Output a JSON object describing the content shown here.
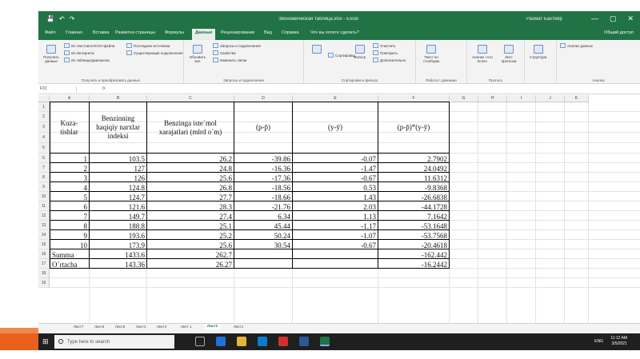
{
  "titlebar": {
    "document": "Экономическая таблица.xlsx  -  Excel",
    "user": "Рахмат Бахтиёр",
    "quick_access": [
      "💾",
      "↶",
      "↷"
    ],
    "window_controls": [
      "—",
      "▢",
      "✕"
    ]
  },
  "tabs": [
    "Файл",
    "Главная",
    "Вставка",
    "Разметка страницы",
    "Формулы",
    "Данные",
    "Рецензирование",
    "Вид",
    "Справка",
    "Что вы хотите сделать?"
  ],
  "active_tab": "Данные",
  "share_label": "Общий доступ",
  "ribbon": {
    "groups": [
      {
        "label": "Получить и преобразовать данные",
        "items": [
          "Получить данные",
          "Из текстового/CSV-файла",
          "Из Интернета",
          "Из таблицы/диапазона",
          "Последние источники",
          "Существующие подключения"
        ]
      },
      {
        "label": "Запросы и подключения",
        "items": [
          "Обновить все",
          "Запросы и подключения",
          "Свойства",
          "Изменить связи"
        ]
      },
      {
        "label": "Сортировка и фильтр",
        "items": [
          "Сортировка",
          "Фильтр",
          "Очистить",
          "Повторить",
          "Дополнительно"
        ]
      },
      {
        "label": "Работа с данными",
        "items": [
          "Текст по столбцам"
        ]
      },
      {
        "label": "Прогноз",
        "items": [
          "Анализ «что если»",
          "Лист прогноза"
        ]
      },
      {
        "label": "Структура",
        "items": [
          "Структура"
        ]
      },
      {
        "label": "Анализ",
        "items": [
          "Анализ данных"
        ]
      }
    ]
  },
  "formula_bar": {
    "name_box": "F31",
    "fx": "fx"
  },
  "columns": [
    "A",
    "B",
    "C",
    "D",
    "E",
    "F",
    "G",
    "H",
    "I",
    "J",
    "K"
  ],
  "rows": [
    "1",
    "2",
    "3",
    "4",
    "5",
    "6",
    "7",
    "8",
    "9",
    "10",
    "11",
    "12",
    "13",
    "14",
    "15",
    "16",
    "17",
    "18",
    "19"
  ],
  "table": {
    "headers": {
      "a": "Kuza-tishlar",
      "b": "Benzinning haqiqiy narxlar indeksi",
      "c": "Benzinga iste`mol xarajatlari (mlrd o`m)",
      "d": "(p-p̄)",
      "e": "(y-ȳ)",
      "f": "(p-p̄)*(y-ȳ)"
    },
    "data": [
      [
        "1",
        "103.5",
        "26.2",
        "-39.86",
        "-0.07",
        "2.7902"
      ],
      [
        "2",
        "127",
        "24.8",
        "-16.36",
        "-1.47",
        "24.0492"
      ],
      [
        "3",
        "126",
        "25.6",
        "-17.36",
        "-0.67",
        "11.6312"
      ],
      [
        "4",
        "124.8",
        "26.8",
        "-18.56",
        "0.53",
        "-9.8368"
      ],
      [
        "5",
        "124.7",
        "27.7",
        "-18.66",
        "1.43",
        "-26.6838"
      ],
      [
        "6",
        "121.6",
        "28.3",
        "-21.76",
        "2.03",
        "-44.1728"
      ],
      [
        "7",
        "149.7",
        "27.4",
        "6.34",
        "1.13",
        "7.1642"
      ],
      [
        "8",
        "188.8",
        "25.1",
        "45.44",
        "-1.17",
        "-53.1648"
      ],
      [
        "9",
        "193.6",
        "25.2",
        "50.24",
        "-1.07",
        "-53.7568"
      ],
      [
        "10",
        "173.9",
        "25.6",
        "30.54",
        "-0.67",
        "-20.4618"
      ]
    ],
    "summa": {
      "label": "Summa",
      "b": "1433.6",
      "c": "262.7",
      "f": "-162.442"
    },
    "ortacha": {
      "label": "O`rtacha",
      "b": "143.36",
      "c": "26.27",
      "f": "-16.2442"
    }
  },
  "sheets": [
    "Лист7",
    "Лист6",
    "Лист5",
    "Лист4",
    "Лист3",
    "Лист 1",
    "Лист2",
    "Лист1"
  ],
  "active_sheet": "Лист2",
  "taskbar": {
    "search_placeholder": "Type here to search",
    "lang": "ENG",
    "time": "11:12 AM",
    "date": "3/5/2021"
  },
  "colors": {
    "excel_green": "#217346",
    "taskbar": "#1f1f1f"
  }
}
